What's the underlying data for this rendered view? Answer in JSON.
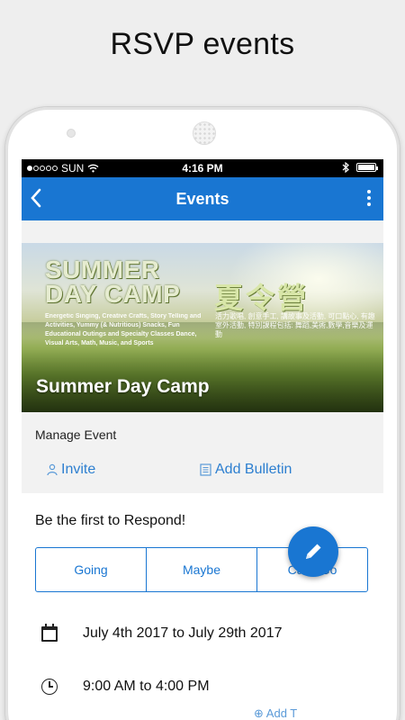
{
  "caption": "RSVP events",
  "status_bar": {
    "carrier": "SUN",
    "time": "4:16 PM"
  },
  "app_bar": {
    "title": "Events",
    "back_icon": "chevron-left-icon",
    "menu_icon": "more-vertical-icon"
  },
  "banner": {
    "headline_en": "SUMMER DAY CAMP",
    "headline_zh": "夏令營",
    "description_en": "Energetic Singing, Creative Crafts, Story Telling and Activities, Yummy (& Nutritious) Snacks, Fun Educational Outings and Specialty Classes Dance, Visual Arts, Math, Music, and Sports",
    "description_zh": "活力歌唱, 創意手工, 講故事及活動, 可口點心, 有趣室外活動, 特別課程包括: 舞蹈,美術,數學,音樂及運動",
    "event_name": "Summer Day Camp"
  },
  "manage": {
    "label": "Manage Event",
    "invite_label": "Invite",
    "bulletin_label": "Add Bulletin"
  },
  "rsvp": {
    "prompt": "Be the first to Respond!",
    "options": [
      "Going",
      "Maybe",
      "Can't Go"
    ]
  },
  "details": {
    "date_range": "July 4th 2017 to July 29th 2017",
    "time_range": "9:00 AM to 4:00 PM",
    "add_to": "Add T"
  },
  "colors": {
    "primary": "#1976d2",
    "link": "#2d7fd0"
  }
}
